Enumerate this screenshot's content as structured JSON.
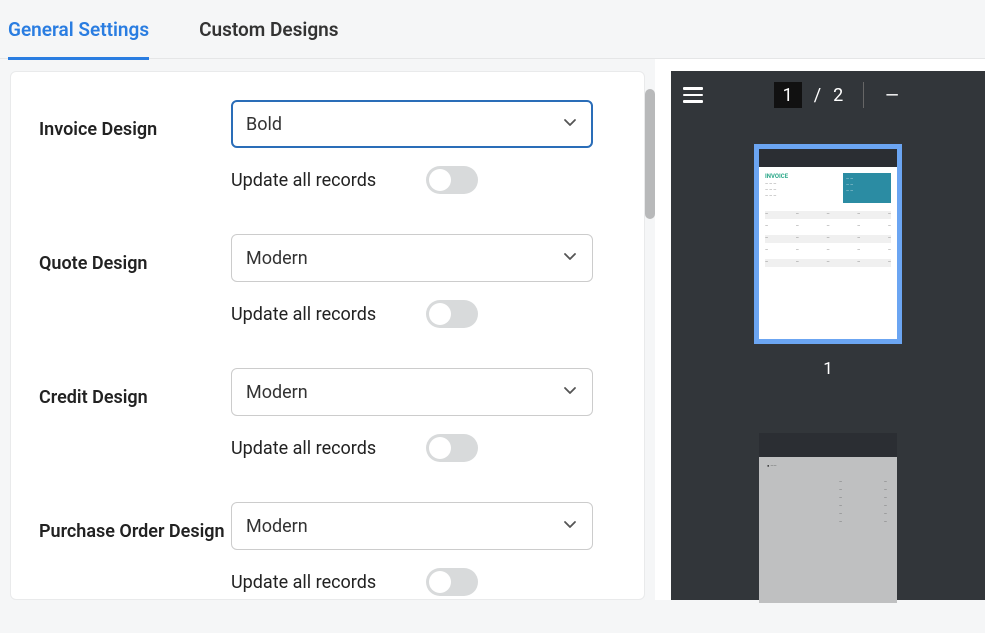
{
  "tabs": {
    "general": "General Settings",
    "custom": "Custom Designs"
  },
  "settings": {
    "invoice": {
      "label": "Invoice Design",
      "selected": "Bold",
      "update_label": "Update all records"
    },
    "quote": {
      "label": "Quote Design",
      "selected": "Modern",
      "update_label": "Update all records"
    },
    "credit": {
      "label": "Credit Design",
      "selected": "Modern",
      "update_label": "Update all records"
    },
    "purchase_order": {
      "label": "Purchase Order Design",
      "selected": "Modern",
      "update_label": "Update all records"
    }
  },
  "pdf": {
    "current_page": "1",
    "page_separator": "/",
    "total_pages": "2",
    "thumb1_label": "1",
    "preview": {
      "title": "INVOICE"
    }
  }
}
